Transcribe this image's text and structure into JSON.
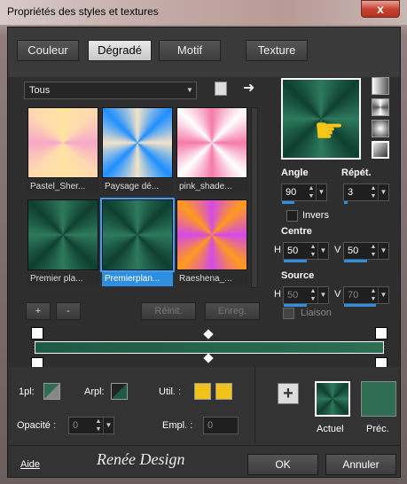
{
  "window": {
    "title": "Propriétés des styles et textures",
    "close_label": "x"
  },
  "tabs": [
    {
      "label": "Couleur"
    },
    {
      "label": "Dégradé"
    },
    {
      "label": "Motif"
    },
    {
      "label": "Texture"
    }
  ],
  "gradient": {
    "dropdown_value": "Tous",
    "thumbnails": [
      {
        "label": "Pastel_Sher..."
      },
      {
        "label": "Paysage dé..."
      },
      {
        "label": "pink_shade..."
      },
      {
        "label": "Premier pla..."
      },
      {
        "label": "Premierplan..."
      },
      {
        "label": "Raeshena_..."
      }
    ],
    "add_label": "+",
    "remove_label": "-",
    "reinit_label": "Réinit.",
    "save_label": "Enreg."
  },
  "settings": {
    "angle_label": "Angle",
    "angle_value": "90",
    "repeat_label": "Répét.",
    "repeat_value": "3",
    "invert_label": "Invers",
    "center_label": "Centre",
    "center_h": "50",
    "center_v": "50",
    "source_label": "Source",
    "source_h": "50",
    "source_v": "70",
    "link_label": "Liaison",
    "h_label": "H",
    "v_label": "V"
  },
  "bottom": {
    "fgpl_label": "1pl:",
    "arpl_label": "Arpl:",
    "util_label": "Util. :",
    "opacity_label": "Opacité :",
    "opacity_value": "0",
    "empl_label": "Empl. :",
    "empl_value": "0",
    "current_label": "Actuel",
    "previous_label": "Préc.",
    "help_label": "Aide",
    "ok_label": "OK",
    "cancel_label": "Annuler",
    "watermark": "Renée Design"
  },
  "colors": {
    "dark_green": "#1e5a45",
    "mid_green": "#2d6e55",
    "accent_blue": "#3aa0ff",
    "yellow": "#f2c21b"
  }
}
